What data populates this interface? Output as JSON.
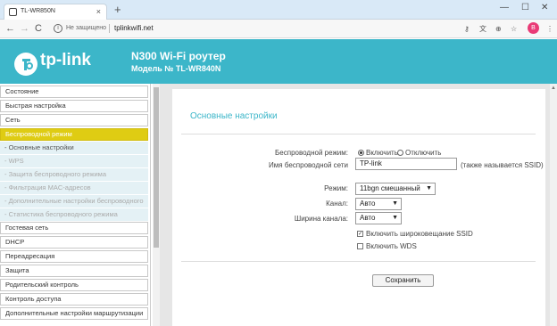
{
  "browser": {
    "tab_title": "TL-WR850N",
    "tab_close": "×",
    "new_tab": "+",
    "window_controls": [
      "—",
      "☐",
      "✕"
    ],
    "nav": {
      "back": "←",
      "forward": "→",
      "reload": "C"
    },
    "security_label": "Не защищено",
    "url": "tplinkwifi.net",
    "avatar_letter": "В",
    "right_icons": [
      "key-icon",
      "translate-icon",
      "zoom-icon",
      "star-icon",
      "menu-icon"
    ]
  },
  "router": {
    "brand": "tp-link",
    "title": "N300 Wi-Fi роутер",
    "model": "Модель № TL-WR840N"
  },
  "sidebar": {
    "items": [
      {
        "label": "Состояние"
      },
      {
        "label": "Быстрая настройка"
      },
      {
        "label": "Сеть"
      },
      {
        "label": "Беспроводной режим",
        "active": true
      }
    ],
    "sub_items": [
      {
        "label": "- Основные настройки",
        "current": true
      },
      {
        "label": "- WPS"
      },
      {
        "label": "- Защита беспроводного режима"
      },
      {
        "label": "- Фильтрация MAC-адресов"
      },
      {
        "label": "- Дополнительные настройки беспроводного"
      },
      {
        "label": "- Статистика беспроводного режима"
      }
    ],
    "items_after": [
      {
        "label": "Гостевая сеть"
      },
      {
        "label": "DHCP"
      },
      {
        "label": "Переадресация"
      },
      {
        "label": "Защита"
      },
      {
        "label": "Родительский контроль"
      },
      {
        "label": "Контроль доступа"
      },
      {
        "label": "Дополнительные настройки маршрутизации"
      }
    ]
  },
  "main": {
    "section_title": "Основные настройки",
    "wireless_mode": {
      "label": "Беспроводной режим:",
      "on_label": "Включить",
      "off_label": "Отключить",
      "value": "on"
    },
    "ssid": {
      "label": "Имя беспроводной сети",
      "value": "TP-link",
      "hint": "(также называется SSID)"
    },
    "mode": {
      "label": "Режим:",
      "value": "11bgn смешанный"
    },
    "channel": {
      "label": "Канал:",
      "value": "Авто"
    },
    "channel_width": {
      "label": "Ширина канала:",
      "value": "Авто"
    },
    "ssid_broadcast": {
      "label": "Включить широковещание SSID",
      "checked": true
    },
    "wds": {
      "label": "Включить WDS",
      "checked": false
    },
    "save_label": "Сохранить"
  },
  "colors": {
    "header": "#3cb6c9",
    "active_menu": "#dfcc13",
    "submenu_bg": "#e4f1f5"
  }
}
